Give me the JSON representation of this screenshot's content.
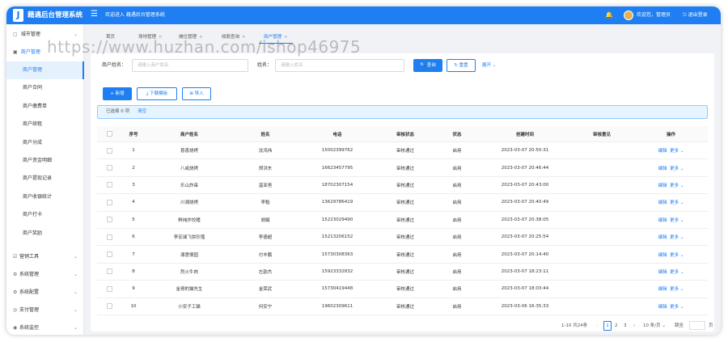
{
  "header": {
    "logo": "J",
    "app_title": "藉遇后台管理系统",
    "menu_toggle": "☰",
    "welcome": "欢迎进入 藉遇后台管理系统",
    "bell": "🔔",
    "greeting": "欢迎您，管理员",
    "logout": "⎋ 退出登录"
  },
  "sidebar": {
    "top": {
      "label": "城市管理",
      "icon": "▢",
      "chev": "⌄"
    },
    "merchant": {
      "label": "商户管理",
      "icon": "▣",
      "chev": "⌃"
    },
    "sub_items": [
      "商户管理",
      "商户合同",
      "商户缴费单",
      "商户续租",
      "商户分成",
      "商户资金明细",
      "商户提现记录",
      "商户收银统计",
      "商户打卡",
      "商户奖励"
    ],
    "groups": [
      {
        "label": "营销工具",
        "icon": "☑",
        "chev": "⌄"
      },
      {
        "label": "系统管理",
        "icon": "⚙",
        "chev": "⌄"
      },
      {
        "label": "系统配置",
        "icon": "⚙",
        "chev": "⌄"
      },
      {
        "label": "支付管理",
        "icon": "◎",
        "chev": "⌄"
      },
      {
        "label": "系统监控",
        "icon": "◉",
        "chev": "⌄"
      }
    ]
  },
  "tabs": [
    {
      "label": "首页",
      "close": ""
    },
    {
      "label": "场地管理",
      "close": "×"
    },
    {
      "label": "摊位管理",
      "close": "×"
    },
    {
      "label": "收款查询",
      "close": "×"
    },
    {
      "label": "商户管理",
      "close": "×"
    }
  ],
  "search": {
    "merchant_label": "商户姓名：",
    "merchant_placeholder": "请输入商户姓名",
    "name_label": "姓名：",
    "name_placeholder": "请输入姓名",
    "search_btn": "🔍 查询",
    "reset_btn": "↻ 重置",
    "expand": "展开 ⌄"
  },
  "toolbar": {
    "add": "+ 新增",
    "download": "⤓ 下载模板",
    "import": "⊞ 导入"
  },
  "selection": {
    "text": "已选择 0 项",
    "clear": "清空"
  },
  "table": {
    "headers": [
      "",
      "序号",
      "商户姓名",
      "姓名",
      "电话",
      "审核状态",
      "状态",
      "创建时间",
      "审核意见",
      "操作"
    ],
    "rows": [
      [
        "1",
        "喜喜烧烤",
        "沈鸿伟",
        "15002399762",
        "审核通过",
        "启用",
        "2023-03-07 20:50:31",
        ""
      ],
      [
        "2",
        "八戒烧烤",
        "郑洪东",
        "16623457795",
        "审核通过",
        "启用",
        "2023-03-07 20:46:44",
        ""
      ],
      [
        "3",
        "乐山炸串",
        "温亚男",
        "18702307154",
        "审核通过",
        "启用",
        "2023-03-07 20:43:00",
        ""
      ],
      [
        "4",
        "川湘烧烤",
        "李魁",
        "13629786419",
        "审核通过",
        "启用",
        "2023-03-07 20:40:49",
        ""
      ],
      [
        "5",
        "鲜炖炸饺猪",
        "胡娟",
        "15223029490",
        "审核通过",
        "启用",
        "2023-03-07 20:38:05",
        ""
      ],
      [
        "6",
        "李宏澜飞饼珍馐",
        "李德超",
        "15213206152",
        "审核通过",
        "启用",
        "2023-03-07 20:25:54",
        ""
      ],
      [
        "7",
        "湘意情园",
        "付丰鹏",
        "15730308363",
        "审核通过",
        "启用",
        "2023-03-07 20:14:40",
        ""
      ],
      [
        "8",
        "烈火牛肉",
        "左韵杰",
        "15923332832",
        "审核通过",
        "启用",
        "2023-03-07 18:23:11",
        ""
      ],
      [
        "9",
        "金哥的猫先生",
        "金荣武",
        "15730419448",
        "审核通过",
        "启用",
        "2023-03-07 18:03:44",
        ""
      ],
      [
        "10",
        "小安子工猫",
        "何安宁",
        "19602309611",
        "审核通过",
        "启用",
        "2023-03-06 16:35:33",
        ""
      ]
    ],
    "op_edit": "编辑",
    "op_more": "更多 ⌄"
  },
  "pager": {
    "summary": "1-10 共24条",
    "prev": "‹",
    "pages": [
      "1",
      "2",
      "3"
    ],
    "next": "›",
    "size": "10 条/页 ⌄",
    "goto": "跳至",
    "page_unit": "页"
  },
  "watermark": "https://www.huzhan.com/ishop46975"
}
